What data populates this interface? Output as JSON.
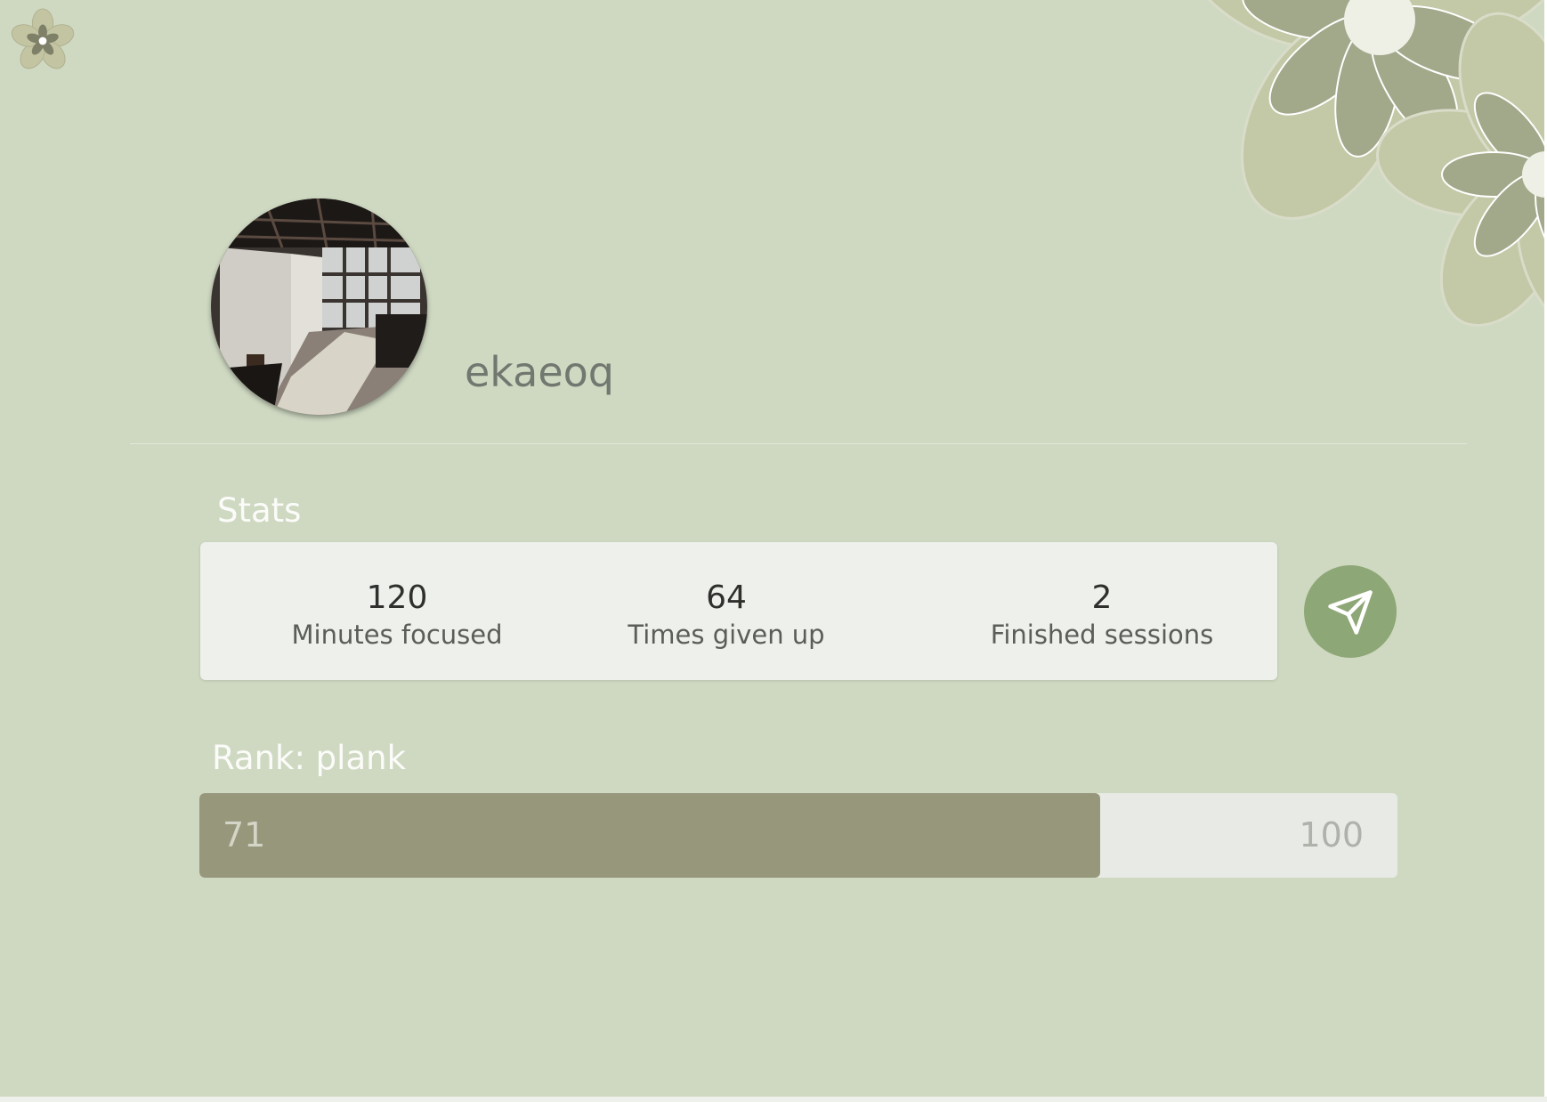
{
  "app": {
    "logo_icon": "flower-icon",
    "background_color": "#cfd9c2",
    "accent_color": "#8ea776"
  },
  "profile": {
    "username": "ekaeoq",
    "avatar": "workshop-interior-photo"
  },
  "stats": {
    "title": "Stats",
    "items": [
      {
        "value": "120",
        "label": "Minutes focused"
      },
      {
        "value": "64",
        "label": "Times given up"
      },
      {
        "value": "2",
        "label": "Finished sessions"
      }
    ],
    "share_icon": "send-icon"
  },
  "rank": {
    "title": "Rank: plank",
    "current": "71",
    "max": "100",
    "progress_fraction": 0.71,
    "fill_color": "#97977c"
  }
}
